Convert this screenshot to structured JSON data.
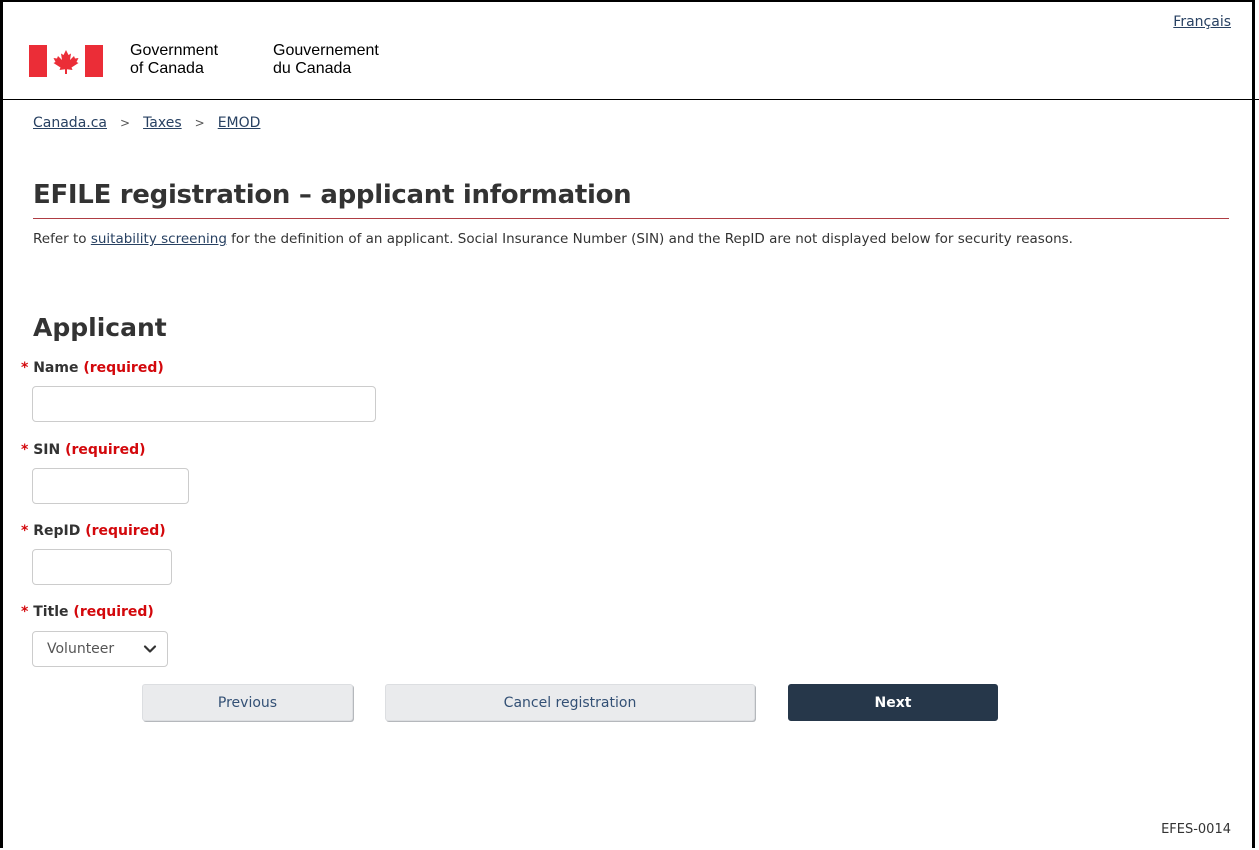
{
  "header": {
    "language_link": "Français",
    "wordmark_en_line1": "Government",
    "wordmark_en_line2": "of Canada",
    "wordmark_fr_line1": "Gouvernement",
    "wordmark_fr_line2": "du Canada",
    "flag_icon": "canada-flag-icon",
    "brand_red": "#eb2d37"
  },
  "breadcrumb": {
    "items": [
      "Canada.ca",
      "Taxes",
      "EMOD"
    ],
    "separator": ">"
  },
  "page": {
    "title": "EFILE registration – applicant information",
    "intro_prefix": "Refer to ",
    "intro_link": "suitability screening",
    "intro_suffix": " for the definition of an applicant. Social Insurance Number (SIN) and the RepID are not displayed below for security reasons."
  },
  "form": {
    "section_title": "Applicant",
    "required_marker": "*",
    "required_text": "(required)",
    "fields": {
      "name": {
        "label": "Name",
        "value": ""
      },
      "sin": {
        "label": "SIN",
        "value": ""
      },
      "repid": {
        "label": "RepID",
        "value": ""
      },
      "title": {
        "label": "Title",
        "selected": "Volunteer"
      }
    }
  },
  "buttons": {
    "previous": "Previous",
    "cancel": "Cancel registration",
    "next": "Next"
  },
  "footer": {
    "page_id": "EFES-0014"
  },
  "colors": {
    "link": "#284162",
    "required": "#d3080c",
    "title_rule": "#af3c43",
    "primary_button": "#26374a"
  }
}
